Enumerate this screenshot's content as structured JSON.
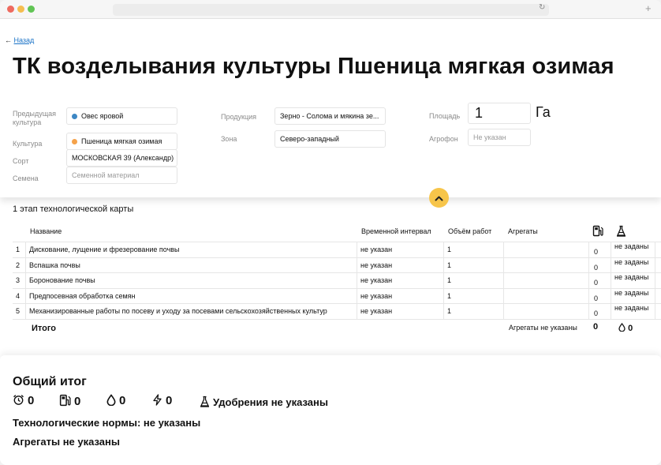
{
  "nav": {
    "back_label": "Назад"
  },
  "page": {
    "title": "ТК возделывания культуры Пшеница мягкая озимая"
  },
  "form": {
    "previous_crop": {
      "label": "Предыдущая культура",
      "value": "Овес яровой",
      "dot_color": "#3d87c4"
    },
    "crop": {
      "label": "Культура",
      "value": "Пшеница мягкая озимая",
      "dot_color": "#f5a24a"
    },
    "variety": {
      "label": "Сорт",
      "value": "МОСКОВСКАЯ 39 (Александр)"
    },
    "seeds": {
      "label": "Семена",
      "placeholder": "Семенной материал"
    },
    "product": {
      "label": "Продукция",
      "value": "Зерно - Солома и мякина зе..."
    },
    "zone": {
      "label": "Зона",
      "value": "Северо-западный"
    },
    "area": {
      "label": "Площадь",
      "value": "1",
      "unit": "Га"
    },
    "agrofon": {
      "label": "Агрофон",
      "placeholder": "Не указан"
    }
  },
  "stage": {
    "title": "1 этап технологической карты",
    "columns": {
      "name": "Название",
      "interval": "Временной интервал",
      "volume": "Объём работ",
      "aggregates": "Агрегаты",
      "fuel_icon": "fuel-pump-icon",
      "fert_icon": "fertilizer-icon"
    },
    "rows": [
      {
        "num": "1",
        "name": "Дискование, лущение и фрезерование почвы",
        "interval": "не указан",
        "volume": "1",
        "aggregates": "",
        "fuel": "0",
        "fert": "не заданы"
      },
      {
        "num": "2",
        "name": "Вспашка почвы",
        "interval": "не указан",
        "volume": "1",
        "aggregates": "",
        "fuel": "0",
        "fert": "не заданы"
      },
      {
        "num": "3",
        "name": "Боронование почвы",
        "interval": "не указан",
        "volume": "1",
        "aggregates": "",
        "fuel": "0",
        "fert": "не заданы"
      },
      {
        "num": "4",
        "name": "Предпосевная обработка семян",
        "interval": "не указан",
        "volume": "1",
        "aggregates": "",
        "fuel": "0",
        "fert": "не заданы"
      },
      {
        "num": "5",
        "name": "Механизированные работы по посеву и уходу за посевами сельскохозяйственных культур",
        "interval": "не указан",
        "volume": "1",
        "aggregates": "",
        "fuel": "0",
        "fert": "не заданы"
      }
    ],
    "total": {
      "label": "Итого",
      "aggregates": "Агрегаты не указаны",
      "fuel": "0",
      "water": "0"
    }
  },
  "summary": {
    "title": "Общий итог",
    "time": "0",
    "fuel": "0",
    "water": "0",
    "energy": "0",
    "fertilizer": "Удобрения не указаны",
    "norms": "Технологические нормы: не указаны",
    "aggregates": "Агрегаты не указаны"
  },
  "colors": {
    "accent": "#f7c54a",
    "link": "#1a73c7"
  }
}
